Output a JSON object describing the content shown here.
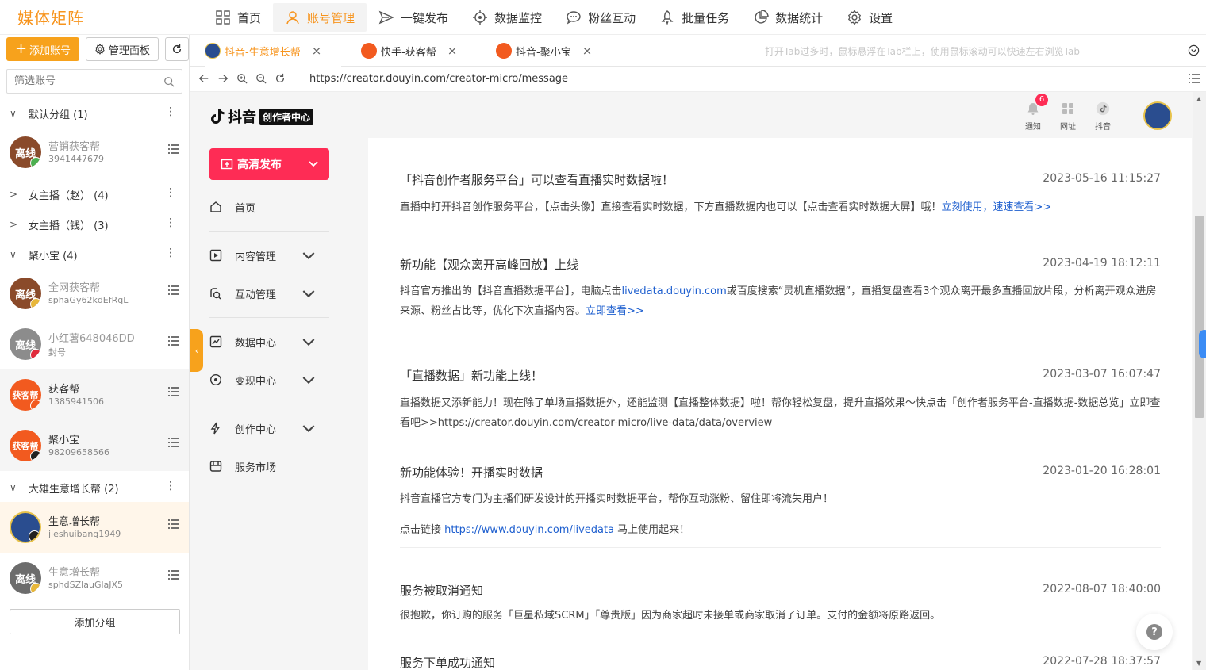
{
  "app": {
    "brand": "媒体矩阵"
  },
  "topnav": [
    {
      "label": "首页"
    },
    {
      "label": "账号管理"
    },
    {
      "label": "一键发布"
    },
    {
      "label": "数据监控"
    },
    {
      "label": "粉丝互动"
    },
    {
      "label": "批量任务"
    },
    {
      "label": "数据统计"
    },
    {
      "label": "设置"
    }
  ],
  "left": {
    "add_account": "添加账号",
    "manage_panel": "管理面板",
    "filter_placeholder": "筛选账号",
    "add_group": "添加分组",
    "groups": [
      {
        "label": "默认分组 (1)"
      },
      {
        "label": "女主播（赵） (4)"
      },
      {
        "label": "女主播（钱） (3)"
      },
      {
        "label": "聚小宝 (4)"
      },
      {
        "label": "大雄生意增长帮 (2)"
      }
    ],
    "accounts": [
      {
        "name": "营销获客帮",
        "id": "3941447679",
        "avatar_text": "离线"
      },
      {
        "name": "全网获客帮",
        "id": "sphaGy62kdEfRqL",
        "avatar_text": "离线"
      },
      {
        "name": "小红薯648046DD",
        "id": "封号",
        "avatar_text": "离线"
      },
      {
        "name": "获客帮",
        "id": "1385941506",
        "avatar_text": "获客帮"
      },
      {
        "name": "聚小宝",
        "id": "98209658566",
        "avatar_text": "获客帮"
      },
      {
        "name": "生意增长帮",
        "id": "jieshuibang1949",
        "avatar_text": ""
      },
      {
        "name": "生意增长帮",
        "id": "sphdSZlauGlaJX5",
        "avatar_text": "离线"
      }
    ]
  },
  "tabs": [
    {
      "label": "抖音-生意增长帮",
      "close": "×"
    },
    {
      "label": "快手-获客帮",
      "close": "×"
    },
    {
      "label": "抖音-聚小宝",
      "close": "×"
    }
  ],
  "tab_hint": "打开Tab过多时，鼠标悬浮在Tab栏上，使用鼠标滚动可以快速左右浏览Tab",
  "url": "https://creator.douyin.com/creator-micro/message",
  "site": {
    "logo_text": "抖音",
    "logo_badge": "创作者中心",
    "publish": "高清发布",
    "menu": [
      {
        "label": "首页"
      },
      {
        "label": "内容管理"
      },
      {
        "label": "互动管理"
      },
      {
        "label": "数据中心"
      },
      {
        "label": "变现中心"
      },
      {
        "label": "创作中心"
      },
      {
        "label": "服务市场"
      }
    ],
    "header": {
      "notify": "通知",
      "notify_count": "6",
      "site": "网址",
      "douyin": "抖音"
    }
  },
  "messages": [
    {
      "title": "「抖音创作者服务平台」可以查看直播实时数据啦！",
      "time": "2023-05-16 11:15:27",
      "body_a": "直播中打开抖音创作服务平台，【点击头像】直接查看实时数据，下方直播数据内也可以【点击查看实时数据大屏】哦！",
      "link_a": "立刻使用",
      "sep": "，",
      "link_b": "速速查看>>"
    },
    {
      "title": "新功能【观众离开高峰回放】上线",
      "time": "2023-04-19 18:12:11",
      "body_a": "抖音官方推出的【抖音直播数据平台】，电脑点击",
      "link_a": "livedata.douyin.com",
      "body_b": "或百度搜索“灵机直播数据”，直播复盘查看3个观众离开最多直播回放片段，分析离开观众进房来源、粉丝占比等，优化下次直播内容。",
      "link_b": "立即查看>>"
    },
    {
      "title": "「直播数据」新功能上线！",
      "time": "2023-03-07 16:07:47",
      "body_a": "直播数据又添新能力！现在除了单场直播数据外，还能监测【直播整体数据】啦！帮你轻松复盘，提升直播效果～快点击「创作者服务平台-直播数据-数据总览」立即查看吧>>https://creator.douyin.com/creator-micro/live-data/data/overview"
    },
    {
      "title": "新功能体验！开播实时数据",
      "time": "2023-01-20 16:28:01",
      "body_a": "抖音直播官方专门为主播们研发设计的开播实时数据平台，帮你互动涨粉、留住即将流失用户！",
      "body_b": "点击链接 ",
      "link_a": "https://www.douyin.com/livedata",
      "body_c": " 马上使用起来！"
    },
    {
      "title": "服务被取消通知",
      "time": "2022-08-07 18:40:00",
      "body_a": "很抱歉，你订购的服务「巨星私域SCRM」「尊贵版」因为商家超时未接单或商家取消了订单。支付的金额将原路返回。"
    },
    {
      "title": "服务下单成功通知",
      "time": "2022-07-28 18:37:57"
    }
  ],
  "colors": {
    "accent": "#f7941d",
    "douyin_red": "#fe2c55",
    "link": "#1e5fcf"
  }
}
